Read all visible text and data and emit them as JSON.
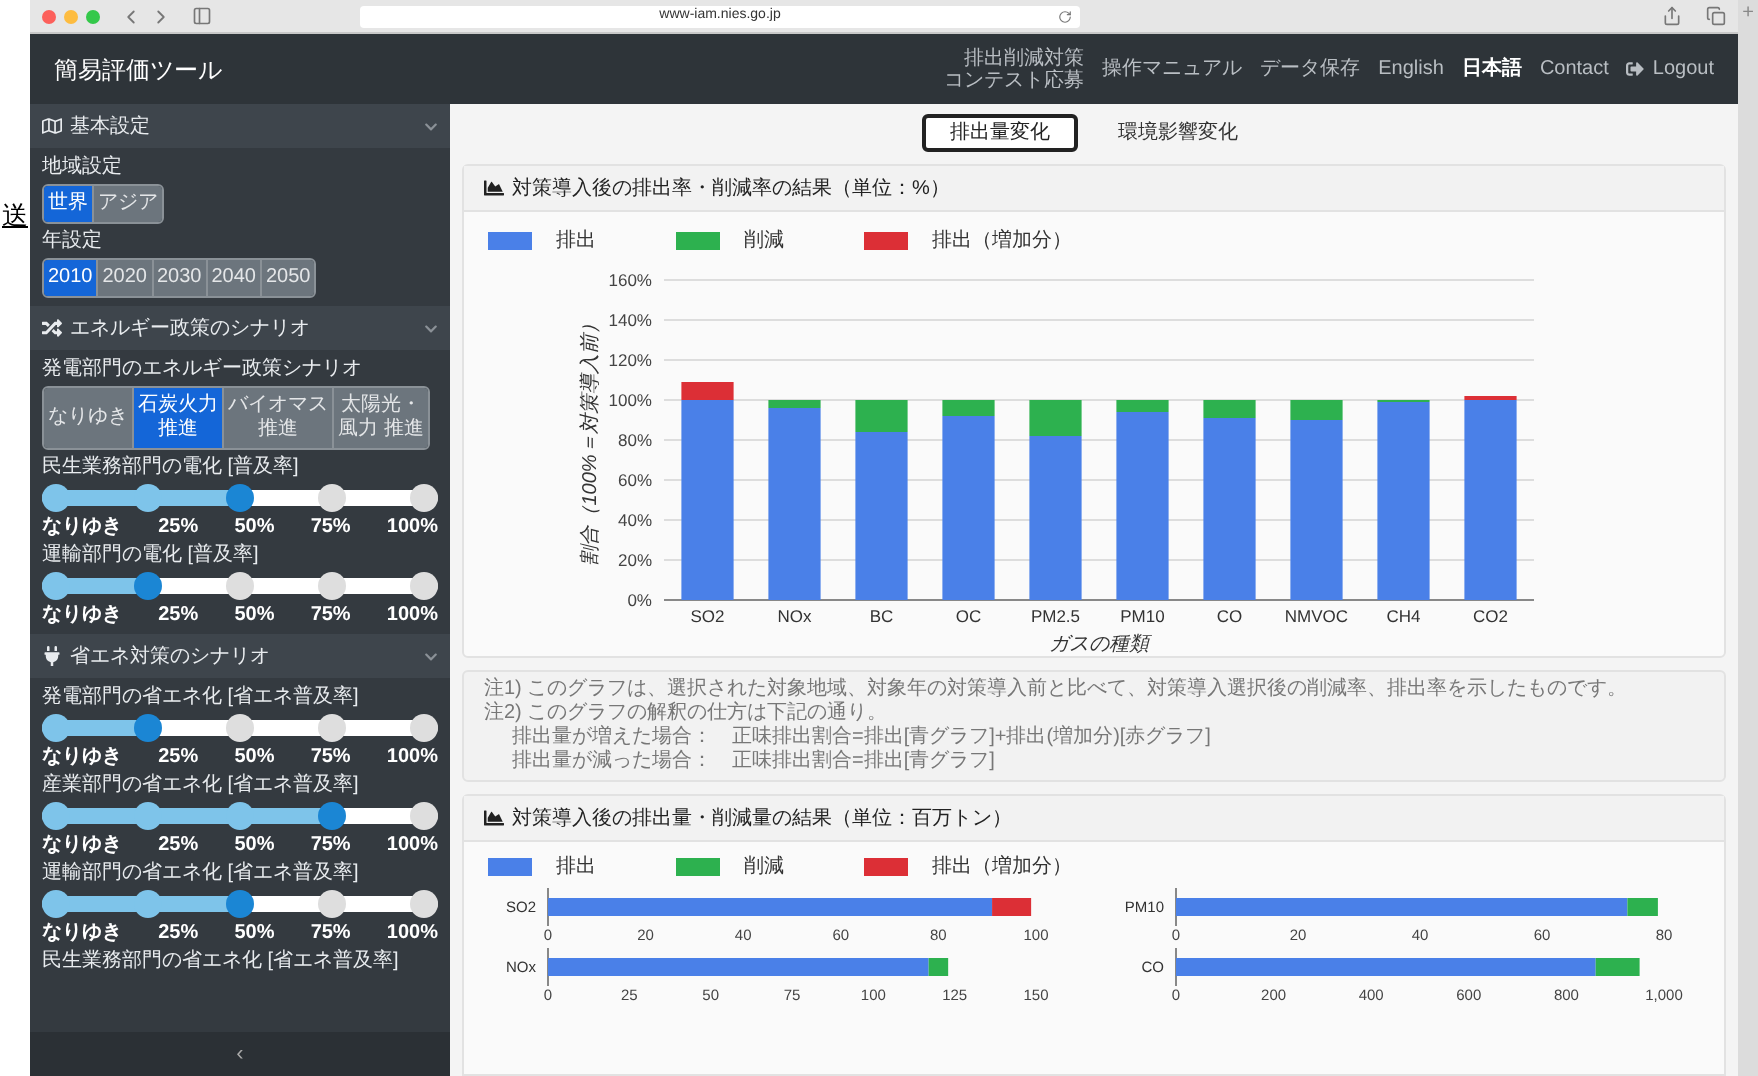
{
  "browser": {
    "url": "www-iam.nies.go.jp",
    "new_tab": "+"
  },
  "overlay_fragment": {
    "text": "送"
  },
  "header": {
    "title": "簡易評価ツール",
    "nav": [
      {
        "lines": [
          "排出削減対策",
          "コンテスト応募"
        ],
        "kind": "small",
        "selected": false
      },
      {
        "label": "操作マニュアル",
        "kind": "link",
        "selected": false
      },
      {
        "label": "データ保存",
        "kind": "link",
        "selected": false
      },
      {
        "label": "English",
        "kind": "link",
        "selected": false
      },
      {
        "label": "日本語",
        "kind": "link",
        "selected": true
      },
      {
        "label": "Contact",
        "kind": "link",
        "selected": false
      },
      {
        "label": "Logout",
        "kind": "logout",
        "selected": false
      }
    ]
  },
  "sidebar": {
    "sections": [
      {
        "title": "基本設定",
        "expanded": true,
        "controls": [
          {
            "kind": "buttons",
            "label": "地域設定",
            "options": [
              {
                "lines": [
                  "世界"
                ],
                "selected": true
              },
              {
                "lines": [
                  "アジア"
                ],
                "selected": false
              }
            ]
          },
          {
            "kind": "buttons",
            "label": "年設定",
            "options": [
              {
                "lines": [
                  "2010"
                ],
                "selected": true
              },
              {
                "lines": [
                  "2020"
                ],
                "selected": false
              },
              {
                "lines": [
                  "2030"
                ],
                "selected": false
              },
              {
                "lines": [
                  "2040"
                ],
                "selected": false
              },
              {
                "lines": [
                  "2050"
                ],
                "selected": false
              }
            ]
          }
        ]
      },
      {
        "title": "エネルギー政策のシナリオ",
        "expanded": true,
        "controls": [
          {
            "kind": "buttons",
            "label": "発電部門のエネルギー政策シナリオ",
            "options": [
              {
                "lines": [
                  "なりゆき"
                ],
                "selected": false
              },
              {
                "lines": [
                  "石炭火力",
                  "推進"
                ],
                "selected": true
              },
              {
                "lines": [
                  "バイオマス",
                  "推進"
                ],
                "selected": false
              },
              {
                "lines": [
                  "太陽光・",
                  "風力 推進"
                ],
                "selected": false
              }
            ]
          },
          {
            "kind": "slider",
            "label": "民生業務部門の電化 [普及率]",
            "level": 0.5,
            "ticks": [
              "なりゆき",
              "25%",
              "50%",
              "75%",
              "100%"
            ]
          },
          {
            "kind": "slider",
            "label": "運輸部門の電化 [普及率]",
            "level": 0.25,
            "ticks": [
              "なりゆき",
              "25%",
              "50%",
              "75%",
              "100%"
            ]
          }
        ]
      },
      {
        "title": "省エネ対策のシナリオ",
        "expanded": true,
        "controls": [
          {
            "kind": "slider",
            "label": "発電部門の省エネ化 [省エネ普及率]",
            "level": 0.25,
            "ticks": [
              "なりゆき",
              "25%",
              "50%",
              "75%",
              "100%"
            ]
          },
          {
            "kind": "slider",
            "label": "産業部門の省エネ化 [省エネ普及率]",
            "level": 0.75,
            "ticks": [
              "なりゆき",
              "25%",
              "50%",
              "75%",
              "100%"
            ]
          },
          {
            "kind": "slider",
            "label": "運輸部門の省エネ化 [省エネ普及率]",
            "level": 0.5,
            "ticks": [
              "なりゆき",
              "25%",
              "50%",
              "75%",
              "100%"
            ]
          },
          {
            "kind": "label",
            "label": "民生業務部門の省エネ化 [省エネ普及率]"
          }
        ]
      }
    ],
    "collapse": "‹"
  },
  "main": {
    "tabs": [
      {
        "label": "排出量変化",
        "selected": true
      },
      {
        "label": "環境影響変化",
        "selected": false
      }
    ],
    "rate_card": {
      "title": "対策導入後の排出率・削減率の結果（単位：%）",
      "chart_data": {
        "type": "bar",
        "stacked": true,
        "grid": true,
        "xlabel": "ガスの種類",
        "ylabel": "割合（100%＝対策導入前）",
        "categories": [
          "SO2",
          "NOx",
          "BC",
          "OC",
          "PM2.5",
          "PM10",
          "CO",
          "NMVOC",
          "CH4",
          "CO2"
        ],
        "series": [
          {
            "name": "排出",
            "color": "#4a80e8",
            "values": [
              100,
              96,
              84,
              92,
              82,
              94,
              91,
              90,
              99,
              100
            ]
          },
          {
            "name": "削減",
            "color": "#2db14f",
            "values": [
              0,
              4,
              16,
              8,
              18,
              6,
              9,
              10,
              1,
              0
            ]
          },
          {
            "name": "排出（増加分）",
            "color": "#dc2f36",
            "values": [
              9,
              0,
              0,
              0,
              0,
              0,
              0,
              0,
              0,
              2
            ]
          }
        ],
        "ylim": [
          0,
          160
        ],
        "yticks": [
          {
            "value": 0,
            "label": "0%"
          },
          {
            "value": 20,
            "label": "20%"
          },
          {
            "value": 40,
            "label": "40%"
          },
          {
            "value": 60,
            "label": "60%"
          },
          {
            "value": 80,
            "label": "80%"
          },
          {
            "value": 100,
            "label": "100%"
          },
          {
            "value": 120,
            "label": "120%"
          },
          {
            "value": 140,
            "label": "140%"
          },
          {
            "value": 160,
            "label": "160%"
          }
        ]
      }
    },
    "notes": [
      {
        "text": "注1) このグラフは、選択された対象地域、対象年の対策導入前と比べて、対策導入選択後の削減率、排出率を示したものです。"
      },
      {
        "text": "注2) このグラフの解釈の仕方は下記の通り。",
        "children": [
          {
            "text": "排出量が増えた場合：　正味排出割合=排出[青グラフ]+排出(増加分)[赤グラフ]"
          },
          {
            "text": "排出量が減った場合：　正味排出割合=排出[青グラフ]"
          }
        ]
      }
    ],
    "amount_card": {
      "title": "対策導入後の排出量・削減量の結果（単位：百万トン）",
      "legend": [
        {
          "label": "排出",
          "color": "#4a80e8"
        },
        {
          "label": "削減",
          "color": "#2db14f"
        },
        {
          "label": "排出（増加分）",
          "color": "#dc2f36"
        }
      ],
      "charts": [
        {
          "chart_data": {
            "type": "bar",
            "orientation": "horizontal",
            "stacked": true,
            "categories": [
              "SO2"
            ],
            "series": [
              {
                "color": "#4a80e8",
                "values": [
                  91
                ]
              },
              {
                "color": "#2db14f",
                "values": [
                  0
                ]
              },
              {
                "color": "#dc2f36",
                "values": [
                  8
                ]
              }
            ],
            "xlim": [
              0,
              100
            ],
            "xticks": [
              0,
              20,
              40,
              60,
              80,
              100
            ]
          }
        },
        {
          "chart_data": {
            "type": "bar",
            "orientation": "horizontal",
            "stacked": true,
            "categories": [
              "PM10"
            ],
            "series": [
              {
                "color": "#4a80e8",
                "values": [
                  74
                ]
              },
              {
                "color": "#2db14f",
                "values": [
                  5
                ]
              },
              {
                "color": "#dc2f36",
                "values": [
                  0
                ]
              }
            ],
            "xlim": [
              0,
              80
            ],
            "xticks": [
              0,
              20,
              40,
              60,
              80
            ]
          }
        },
        {
          "chart_data": {
            "type": "bar",
            "orientation": "horizontal",
            "stacked": true,
            "categories": [
              "NOx"
            ],
            "series": [
              {
                "color": "#4a80e8",
                "values": [
                  117
                ]
              },
              {
                "color": "#2db14f",
                "values": [
                  6
                ]
              },
              {
                "color": "#dc2f36",
                "values": [
                  0
                ]
              }
            ],
            "xlim": [
              0,
              150
            ],
            "xticks": [
              0,
              25,
              50,
              75,
              100,
              125,
              150
            ]
          }
        },
        {
          "chart_data": {
            "type": "bar",
            "orientation": "horizontal",
            "stacked": true,
            "categories": [
              "CO"
            ],
            "series": [
              {
                "color": "#4a80e8",
                "values": [
                  860
                ]
              },
              {
                "color": "#2db14f",
                "values": [
                  90
                ]
              },
              {
                "color": "#dc2f36",
                "values": [
                  0
                ]
              }
            ],
            "xlim": [
              0,
              1000
            ],
            "xticks": [
              0,
              200,
              400,
              600,
              800,
              {
                "value": 1000,
                "label": "1,000"
              }
            ]
          }
        }
      ]
    }
  }
}
